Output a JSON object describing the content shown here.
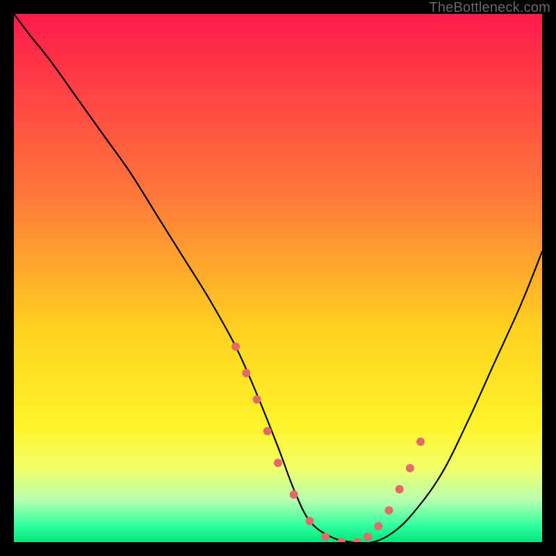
{
  "watermark": "TheBottleneck.com",
  "chart_data": {
    "type": "line",
    "title": "",
    "xlabel": "",
    "ylabel": "",
    "xlim": [
      0,
      100
    ],
    "ylim": [
      0,
      100
    ],
    "gradient_stops": [
      {
        "offset": 0,
        "color": "#ff1a4b"
      },
      {
        "offset": 35,
        "color": "#ff7a3a"
      },
      {
        "offset": 60,
        "color": "#ffd21f"
      },
      {
        "offset": 78,
        "color": "#fff42a"
      },
      {
        "offset": 86,
        "color": "#f2ff6a"
      },
      {
        "offset": 92,
        "color": "#b8ffb0"
      },
      {
        "offset": 97,
        "color": "#2eff9e"
      },
      {
        "offset": 100,
        "color": "#00e67a"
      }
    ],
    "series": [
      {
        "name": "bottleneck-curve",
        "x": [
          0,
          3,
          7,
          12,
          17,
          22,
          27,
          32,
          37,
          42,
          46,
          50,
          53,
          56,
          60,
          64,
          68,
          72,
          76,
          81,
          86,
          91,
          96,
          100
        ],
        "y": [
          100,
          96,
          91,
          84,
          77,
          70,
          62,
          54,
          46,
          37,
          28,
          18,
          10,
          4,
          1,
          0,
          0,
          2,
          6,
          13,
          23,
          34,
          45,
          55
        ]
      }
    ],
    "scatter": {
      "name": "sample-points",
      "x": [
        42,
        44,
        46,
        48,
        50,
        53,
        56,
        59,
        62,
        65,
        67,
        69,
        71,
        73,
        75,
        77
      ],
      "y": [
        37,
        32,
        27,
        21,
        15,
        9,
        4,
        1,
        0,
        0,
        1,
        3,
        6,
        10,
        14,
        19
      ],
      "color": "#e46a6a",
      "radius": 6
    }
  }
}
